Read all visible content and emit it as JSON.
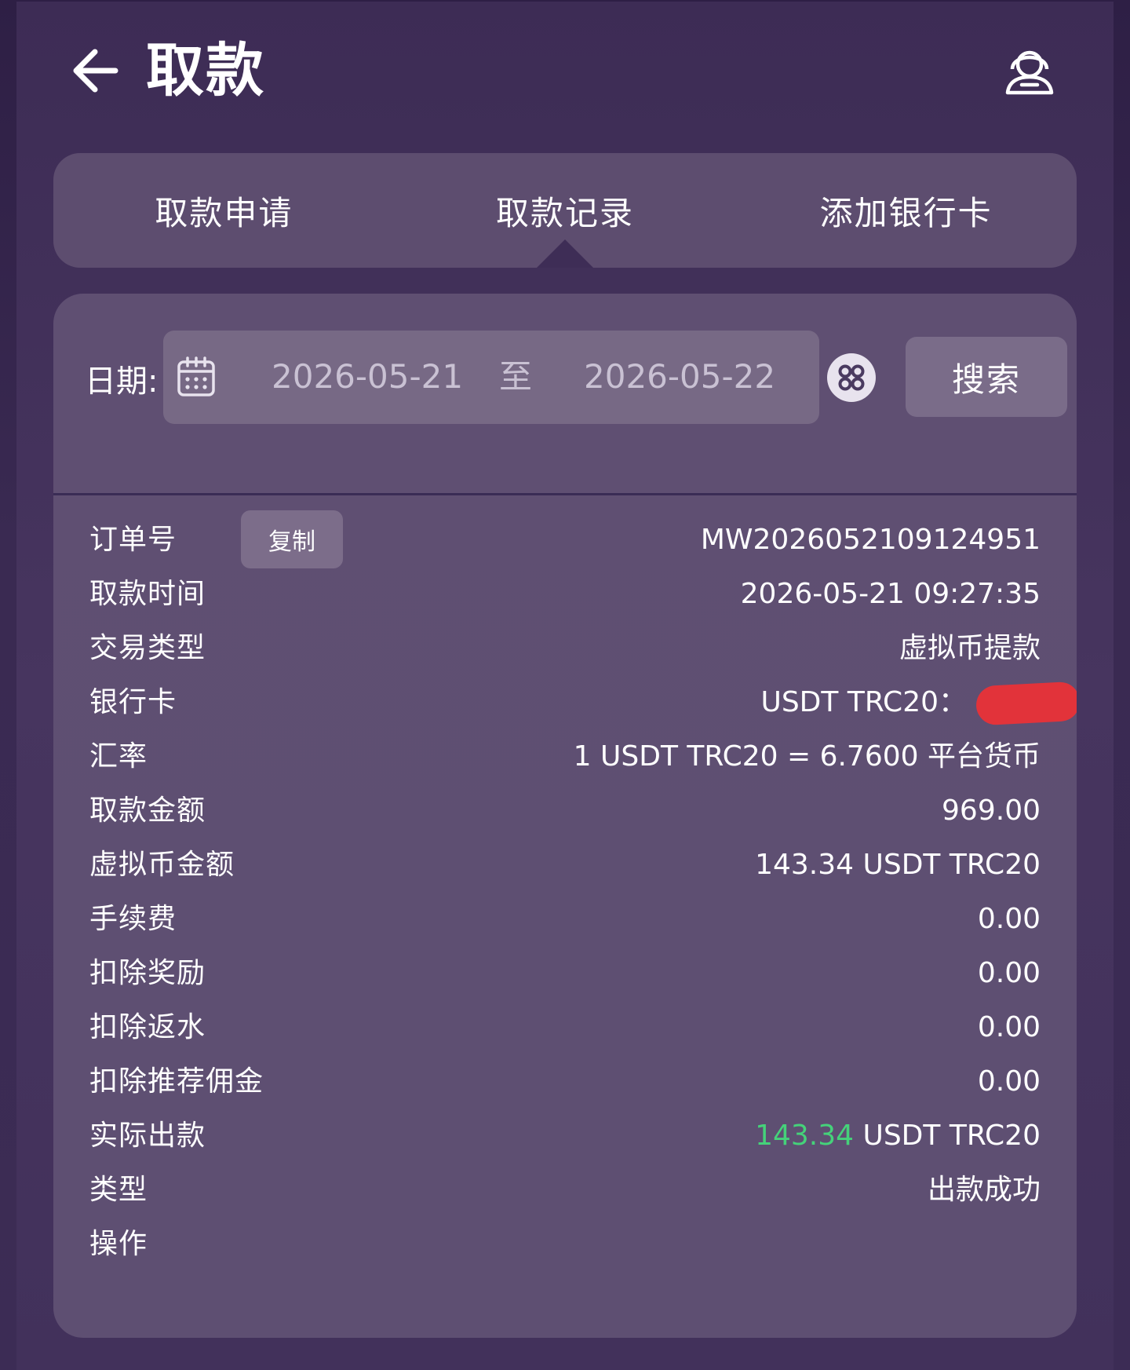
{
  "header": {
    "title": "取款"
  },
  "tabs": [
    {
      "label": "取款申请"
    },
    {
      "label": "取款记录"
    },
    {
      "label": "添加银行卡"
    }
  ],
  "filter": {
    "date_label": "日期:",
    "start_date": "2026-05-21",
    "separator": "至",
    "end_date": "2026-05-22",
    "search_label": "搜索"
  },
  "record": {
    "order_no_label": "订单号",
    "copy_label": "复制",
    "order_no": "MW2026052109124951",
    "time_label": "取款时间",
    "time": "2026-05-21 09:27:35",
    "tx_type_label": "交易类型",
    "tx_type": "虚拟币提款",
    "bank_card_label": "银行卡",
    "bank_card": "USDT TRC20：",
    "rate_label": "汇率",
    "rate": "1 USDT TRC20 = 6.7600 平台货币",
    "amount_label": "取款金额",
    "amount": "969.00",
    "crypto_amount_label": "虚拟币金额",
    "crypto_amount": "143.34 USDT TRC20",
    "fee_label": "手续费",
    "fee": "0.00",
    "deduct_bonus_label": "扣除奖励",
    "deduct_bonus": "0.00",
    "deduct_rebate_label": "扣除返水",
    "deduct_rebate": "0.00",
    "deduct_commission_label": "扣除推荐佣金",
    "deduct_commission": "0.00",
    "actual_label": "实际出款",
    "actual_amount": "143.34",
    "actual_unit": " USDT TRC20",
    "type_label": "类型",
    "type": "出款成功",
    "action_label": "操作"
  },
  "colors": {
    "background": "#42315b",
    "panel": "#5e4f72",
    "success": "#45d27a",
    "redaction": "#e2333a"
  },
  "icons": {
    "back": "arrow-left-icon",
    "support": "customer-service-icon",
    "calendar": "calendar-icon",
    "quick_select": "grid-icon"
  }
}
